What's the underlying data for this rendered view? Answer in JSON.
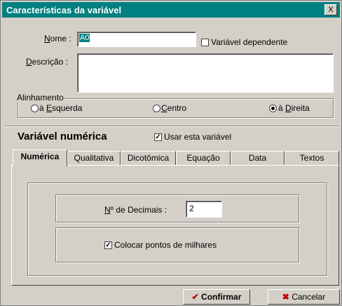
{
  "window": {
    "title": "Características da variável",
    "close_label": "X"
  },
  "form": {
    "nome_label_u": "N",
    "nome_label_rest": "ome :",
    "nome_value": "A0",
    "dependent_label": "Variável dependente",
    "dependent_checked": false,
    "descricao_label_u": "D",
    "descricao_label_rest": "escrição :",
    "descricao_value": ""
  },
  "alignment": {
    "legend": "Alinhamento",
    "left_prefix": "à ",
    "left_u": "E",
    "left_rest": "squerda",
    "center_u": "C",
    "center_rest": "entro",
    "right_prefix": "à ",
    "right_u": "D",
    "right_rest": "ireita",
    "selected": "right"
  },
  "section": {
    "title": "Variável numérica",
    "use_label": "Usar esta variável",
    "use_checked": true
  },
  "tabs": [
    {
      "label": "Numérica",
      "active": true
    },
    {
      "label": "Qualitativa",
      "active": false
    },
    {
      "label": "Dicotômica",
      "active": false
    },
    {
      "label": "Equação",
      "active": false
    },
    {
      "label": "Data",
      "active": false
    },
    {
      "label": "Textos",
      "active": false
    }
  ],
  "numeric": {
    "decimals_label_u": "N",
    "decimals_label_rest": "º de Decimais :",
    "decimals_value": "2",
    "thousands_label": "Colocar pontos de milhares",
    "thousands_checked": true
  },
  "buttons": {
    "confirm_label": "Confirmar",
    "cancel_label": "Cancelar"
  }
}
